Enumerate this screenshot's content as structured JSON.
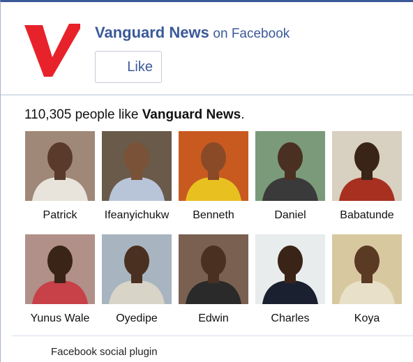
{
  "header": {
    "page_name": "Vanguard News",
    "on_text": "on Facebook",
    "like_label": "Like",
    "logo_letter": "V",
    "logo_color": "#e8222a",
    "brand_color": "#3b5998"
  },
  "summary": {
    "count": "110,305",
    "middle": "people like",
    "page_name": "Vanguard News",
    "end": "."
  },
  "fans": [
    {
      "name": "Patrick",
      "bg": "#a08878",
      "skin": "#5a3a2a",
      "shirt": "#e8e4dc"
    },
    {
      "name": "Ifeanyichukw",
      "bg": "#6a5a4a",
      "skin": "#7a5238",
      "shirt": "#b8c4d8"
    },
    {
      "name": "Benneth",
      "bg": "#c85a20",
      "skin": "#8a4a28",
      "shirt": "#e8c020"
    },
    {
      "name": "Daniel",
      "bg": "#7a9a7a",
      "skin": "#4a3020",
      "shirt": "#3a3a3a"
    },
    {
      "name": "Babatunde",
      "bg": "#d8d0c0",
      "skin": "#3a2418",
      "shirt": "#a83020"
    },
    {
      "name": "Yunus Wale",
      "bg": "#b09088",
      "skin": "#3a2418",
      "shirt": "#c84048"
    },
    {
      "name": "Oyedipe",
      "bg": "#a8b4c0",
      "skin": "#4a3020",
      "shirt": "#d8d4c8"
    },
    {
      "name": "Edwin",
      "bg": "#7a6050",
      "skin": "#4a3020",
      "shirt": "#2a2a2a"
    },
    {
      "name": "Charles",
      "bg": "#e8ecec",
      "skin": "#3a2418",
      "shirt": "#1a2030"
    },
    {
      "name": "Koya",
      "bg": "#d8c8a0",
      "skin": "#5a3a22",
      "shirt": "#e8e0c8"
    }
  ],
  "footer": {
    "text": "Facebook social plugin"
  }
}
